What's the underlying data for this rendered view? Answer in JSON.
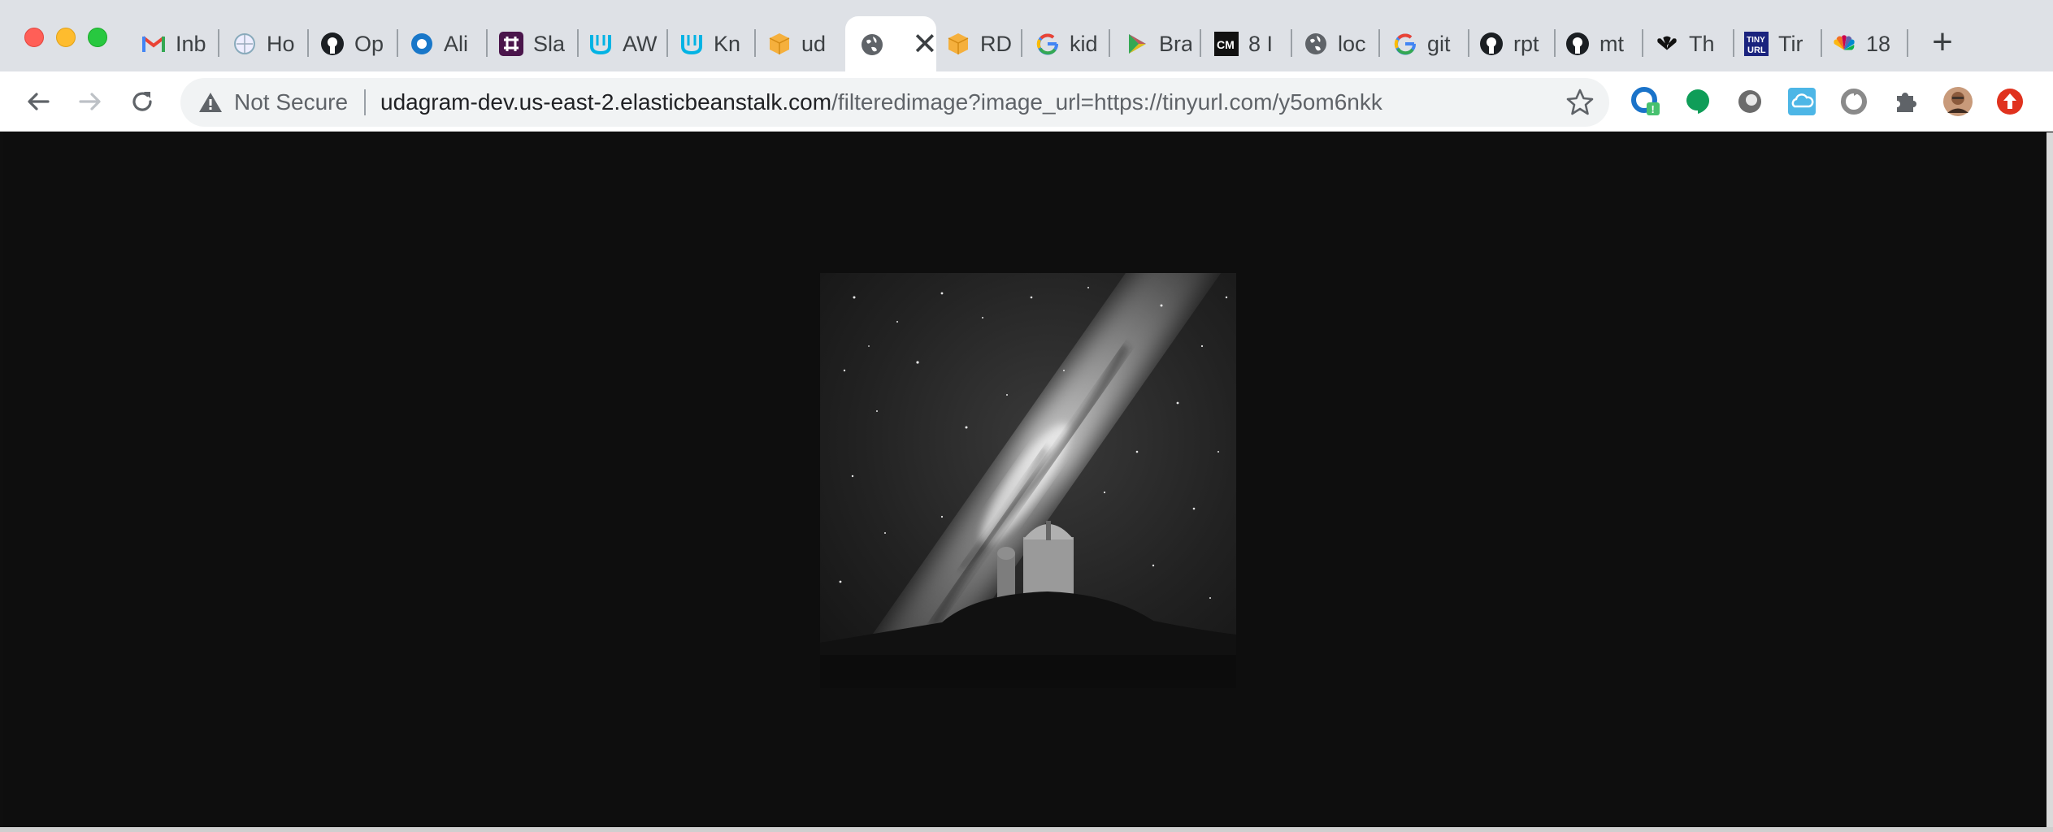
{
  "window": {
    "traffic_lights": [
      "close",
      "minimize",
      "maximize"
    ]
  },
  "tabs": [
    {
      "label": "Inb",
      "icon": "gmail-icon"
    },
    {
      "label": "Ho",
      "icon": "globe-outline-icon"
    },
    {
      "label": "Op",
      "icon": "github-icon"
    },
    {
      "label": "Ali",
      "icon": "circle-blue-icon"
    },
    {
      "label": "Sla",
      "icon": "slack-icon"
    },
    {
      "label": "AW",
      "icon": "udacity-icon"
    },
    {
      "label": "Kn",
      "icon": "udacity-icon"
    },
    {
      "label": "ud",
      "icon": "box-icon"
    },
    {
      "label": "",
      "icon": "globe-icon",
      "active": true
    },
    {
      "label": "RD",
      "icon": "box-icon"
    },
    {
      "label": "kid",
      "icon": "google-icon"
    },
    {
      "label": "Bra",
      "icon": "play-icon"
    },
    {
      "label": "8 I",
      "icon": "cm-icon"
    },
    {
      "label": "loc",
      "icon": "globe-icon"
    },
    {
      "label": "git",
      "icon": "google-icon"
    },
    {
      "label": "rpt",
      "icon": "github-icon"
    },
    {
      "label": "mt",
      "icon": "github-icon"
    },
    {
      "label": "Th",
      "icon": "nbc-icon"
    },
    {
      "label": "Tir",
      "icon": "tinyurl-icon"
    },
    {
      "label": "18",
      "icon": "nbc-color-icon"
    }
  ],
  "new_tab_label": "+",
  "close_tab_glyph": "✕",
  "toolbar": {
    "back_icon": "back-arrow-icon",
    "forward_icon": "forward-arrow-icon",
    "reload_icon": "reload-icon"
  },
  "omnibox": {
    "security_text": "Not Secure",
    "url_host": "udagram-dev.us-east-2.elasticbeanstalk.com",
    "url_path": "/filteredimage?image_url=https://tinyurl.com/y5om6nkk",
    "bookmark_icon": "star-outline-icon"
  },
  "extensions": [
    "grammar-extension-icon",
    "hangouts-icon",
    "record-icon",
    "cloud-extension-icon",
    "refresh-extension-icon",
    "puzzle-icon",
    "profile-avatar",
    "update-arrow-icon"
  ],
  "extension_badge": "!",
  "content": {
    "image_alt": "Grayscale photo of the Milky Way above an observatory dome"
  },
  "colors": {
    "tabstrip_bg": "#dee1e6",
    "page_bg": "#0e0e0e",
    "url_host": "#202124",
    "url_path": "#5f6368"
  }
}
